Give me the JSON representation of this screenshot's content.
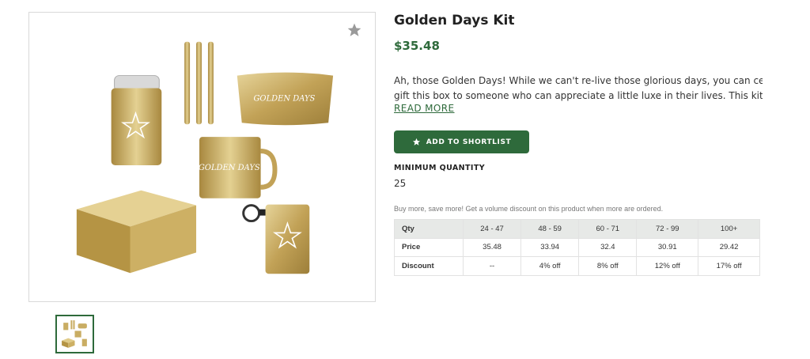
{
  "product": {
    "title": "Golden Days Kit",
    "price": "$35.48",
    "description_line1": "Ah, those Golden Days! While we can't re-live those glorious days, you can certainly",
    "description_line2": "gift this box to someone who can appreciate a little luxe in their lives. This kit come…",
    "read_more": "READ MORE",
    "add_button": "ADD TO SHORTLIST",
    "min_qty_label": "MINIMUM QUANTITY",
    "min_qty_value": "25",
    "volume_note": "Buy more, save more! Get a volume discount on this product when more are ordered."
  },
  "art": {
    "koozie_text": "",
    "pouch_text": "GOLDEN DAYS",
    "mug_text": "GOLDEN DAYS"
  },
  "pricing_table": {
    "header": [
      "Qty",
      "24 - 47",
      "48 - 59",
      "60 - 71",
      "72 - 99",
      "100+"
    ],
    "price_row": [
      "Price",
      "35.48",
      "33.94",
      "32.4",
      "30.91",
      "29.42"
    ],
    "discount_row": [
      "Discount",
      "--",
      "4% off",
      "8% off",
      "12% off",
      "17% off"
    ]
  },
  "colors": {
    "brand_green": "#2e6a3b",
    "gold": "#c9ad63"
  },
  "icons": {
    "favorite": "star-icon",
    "button": "star-icon"
  }
}
